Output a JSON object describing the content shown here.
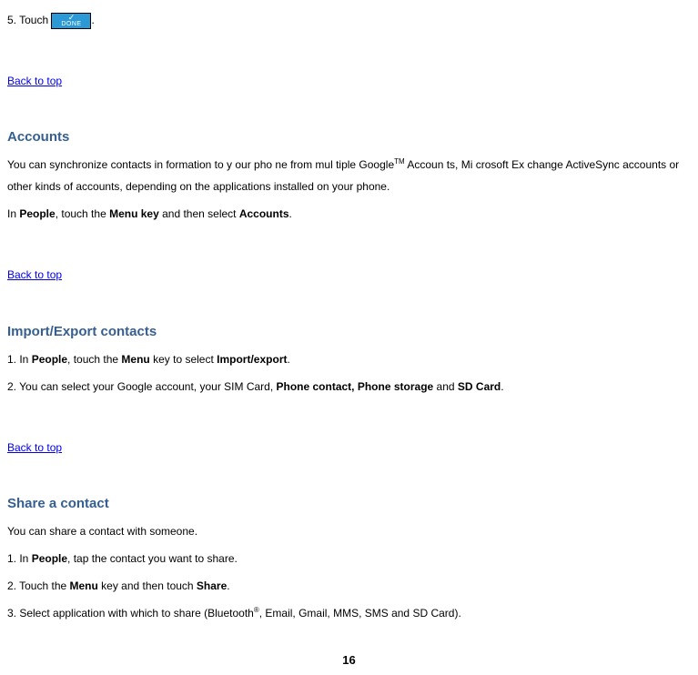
{
  "step5": {
    "prefix": "5. Touch ",
    "suffix": "."
  },
  "doneButton": {
    "check": "✓",
    "label": "DONE"
  },
  "links": {
    "backToTop": "Back to top"
  },
  "sections": {
    "accounts": {
      "heading": "Accounts",
      "p1_a": "You can   synchronize  contacts in formation  to y our pho ne  from mul tiple  Google",
      "p1_sup": "TM",
      "p1_b": " Accoun ts, Mi crosoft Ex change ActiveSync accounts or other kinds of accounts, depending on the applications installed on your phone.",
      "p2_a": "In ",
      "p2_b": "People",
      "p2_c": ", touch the ",
      "p2_d": "Menu key",
      "p2_e": " and then select ",
      "p2_f": "Accounts",
      "p2_g": "."
    },
    "importExport": {
      "heading": "Import/Export contacts",
      "l1_a": "1. In ",
      "l1_b": "People",
      "l1_c": ", touch the ",
      "l1_d": "Menu",
      "l1_e": " key to select ",
      "l1_f": "Import/export",
      "l1_g": ".",
      "l2_a": "2. You can select your Google account, your SIM Card, ",
      "l2_b": "Phone contact, Phone storage",
      "l2_c": " and ",
      "l2_d": "SD Card",
      "l2_e": "."
    },
    "shareContact": {
      "heading": "Share a contact",
      "p1": "You can share a contact with someone.",
      "l1_a": "1. In ",
      "l1_b": "People",
      "l1_c": ", tap the contact you want to share.",
      "l2_a": "2. Touch the ",
      "l2_b": "Menu",
      "l2_c": " key and then touch ",
      "l2_d": "Share",
      "l2_e": ".",
      "l3_a": "3. Select application with which to share (Bluetooth",
      "l3_sup": "®",
      "l3_b": ", Email, Gmail, MMS, SMS and SD Card)."
    }
  },
  "pageNumber": "16"
}
